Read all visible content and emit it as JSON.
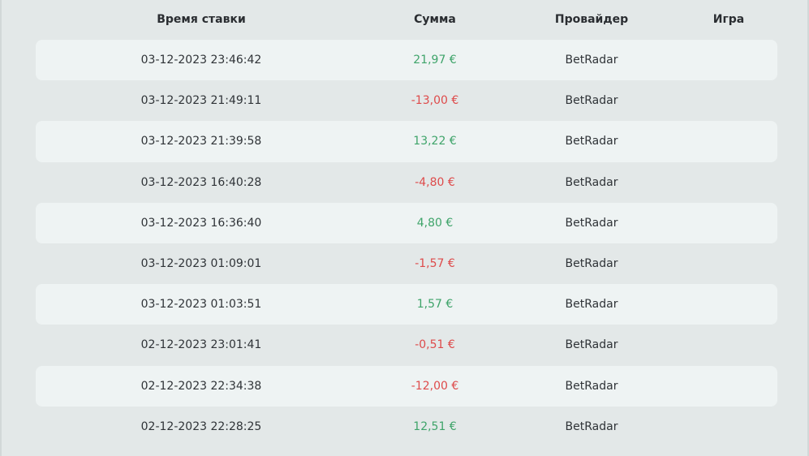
{
  "colors": {
    "background": "#e3e8e8",
    "row_stripe": "#eef3f3",
    "positive": "#3fa46a",
    "negative": "#de4b4b"
  },
  "table": {
    "headers": {
      "time": "Время ставки",
      "sum": "Сумма",
      "provider": "Провайдер",
      "game": "Игра"
    },
    "rows": [
      {
        "time": "03-12-2023 23:46:42",
        "sum": "21,97 €",
        "sign": "pos",
        "provider": "BetRadar",
        "game": ""
      },
      {
        "time": "03-12-2023 21:49:11",
        "sum": "-13,00 €",
        "sign": "neg",
        "provider": "BetRadar",
        "game": ""
      },
      {
        "time": "03-12-2023 21:39:58",
        "sum": "13,22 €",
        "sign": "pos",
        "provider": "BetRadar",
        "game": ""
      },
      {
        "time": "03-12-2023 16:40:28",
        "sum": "-4,80 €",
        "sign": "neg",
        "provider": "BetRadar",
        "game": ""
      },
      {
        "time": "03-12-2023 16:36:40",
        "sum": "4,80 €",
        "sign": "pos",
        "provider": "BetRadar",
        "game": ""
      },
      {
        "time": "03-12-2023 01:09:01",
        "sum": "-1,57 €",
        "sign": "neg",
        "provider": "BetRadar",
        "game": ""
      },
      {
        "time": "03-12-2023 01:03:51",
        "sum": "1,57 €",
        "sign": "pos",
        "provider": "BetRadar",
        "game": ""
      },
      {
        "time": "02-12-2023 23:01:41",
        "sum": "-0,51 €",
        "sign": "neg",
        "provider": "BetRadar",
        "game": ""
      },
      {
        "time": "02-12-2023 22:34:38",
        "sum": "-12,00 €",
        "sign": "neg",
        "provider": "BetRadar",
        "game": ""
      },
      {
        "time": "02-12-2023 22:28:25",
        "sum": "12,51 €",
        "sign": "pos",
        "provider": "BetRadar",
        "game": ""
      }
    ]
  }
}
